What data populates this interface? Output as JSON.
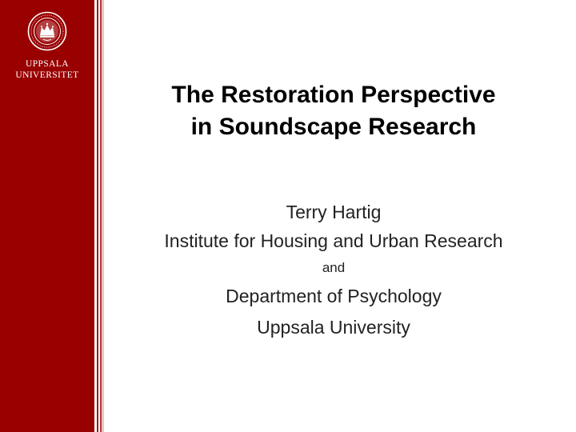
{
  "logo": {
    "line1": "UPPSALA",
    "line2": "UNIVERSITET",
    "seal_icon": "university-seal"
  },
  "title": {
    "line1": "The Restoration Perspective",
    "line2": "in Soundscape Research"
  },
  "subtitle": {
    "author": "Terry Hartig",
    "institution1": "Institute for Housing and Urban Research",
    "conjunction": "and",
    "institution2": "Department of Psychology",
    "institution3": "Uppsala University"
  },
  "colors": {
    "sidebar": "#990000",
    "text": "#000000",
    "logo_text": "#ffffff"
  }
}
